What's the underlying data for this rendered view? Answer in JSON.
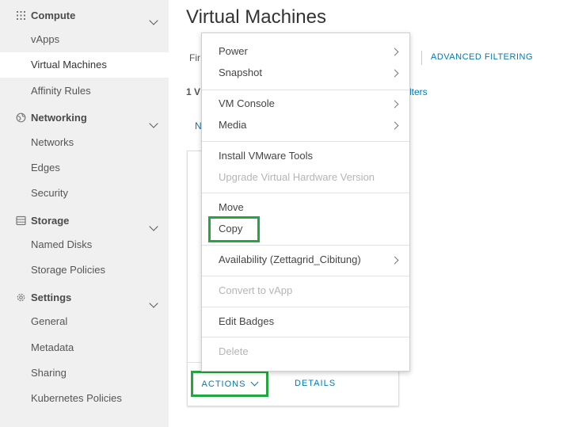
{
  "sidebar": {
    "sections": [
      {
        "title": "Compute",
        "icon": "grid-icon",
        "items": [
          "vApps",
          "Virtual Machines",
          "Affinity Rules"
        ]
      },
      {
        "title": "Networking",
        "icon": "network-icon",
        "items": [
          "Networks",
          "Edges",
          "Security"
        ]
      },
      {
        "title": "Storage",
        "icon": "storage-icon",
        "items": [
          "Named Disks",
          "Storage Policies"
        ]
      },
      {
        "title": "Settings",
        "icon": "gear-icon",
        "items": [
          "General",
          "Metadata",
          "Sharing",
          "Kubernetes Policies"
        ]
      }
    ],
    "active_item": "Virtual Machines"
  },
  "main": {
    "title": "Virtual Machines",
    "filter_partial": "Fir",
    "count_partial": "1 V",
    "filters_link_partial": "lters",
    "n_partial": "N",
    "advanced_filtering": "ADVANCED FILTERING"
  },
  "card": {
    "actions_label": "ACTIONS",
    "details_label": "DETAILS"
  },
  "context_menu": {
    "items": [
      {
        "label": "Power",
        "submenu": true,
        "enabled": true
      },
      {
        "label": "Snapshot",
        "submenu": true,
        "enabled": true
      },
      {
        "label": "VM Console",
        "submenu": true,
        "enabled": true
      },
      {
        "label": "Media",
        "submenu": true,
        "enabled": true
      },
      {
        "label": "Install VMware Tools",
        "submenu": false,
        "enabled": true
      },
      {
        "label": "Upgrade Virtual Hardware Version",
        "submenu": false,
        "enabled": false
      },
      {
        "label": "Move",
        "submenu": false,
        "enabled": true
      },
      {
        "label": "Copy",
        "submenu": false,
        "enabled": true,
        "highlighted": true
      },
      {
        "label": "Availability (Zettagrid_Cibitung)",
        "submenu": true,
        "enabled": true
      },
      {
        "label": "Convert to vApp",
        "submenu": false,
        "enabled": false
      },
      {
        "label": "Edit Badges",
        "submenu": false,
        "enabled": true
      },
      {
        "label": "Delete",
        "submenu": false,
        "enabled": false
      }
    ]
  },
  "colors": {
    "highlight_border": "#22a640",
    "link": "#0079b8",
    "sidebar_bg": "#f0f0f0"
  }
}
